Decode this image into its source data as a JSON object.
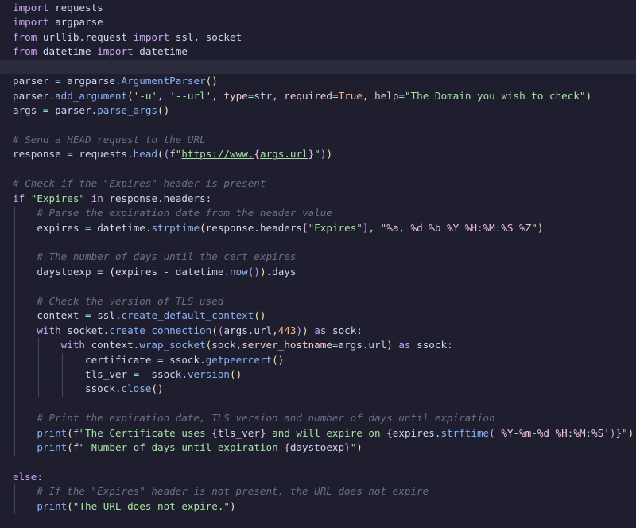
{
  "editor": {
    "language": "Python",
    "lines": [
      {
        "indent": 0,
        "current": false,
        "tokens": [
          [
            "kw",
            "import"
          ],
          [
            "plain",
            " requests"
          ]
        ]
      },
      {
        "indent": 0,
        "current": false,
        "tokens": [
          [
            "kw",
            "import"
          ],
          [
            "plain",
            " argparse"
          ]
        ]
      },
      {
        "indent": 0,
        "current": false,
        "tokens": [
          [
            "kw",
            "from"
          ],
          [
            "plain",
            " urllib.request "
          ],
          [
            "kw",
            "import"
          ],
          [
            "plain",
            " ssl, socket"
          ]
        ]
      },
      {
        "indent": 0,
        "current": false,
        "tokens": [
          [
            "kw",
            "from"
          ],
          [
            "plain",
            " datetime "
          ],
          [
            "kw",
            "import"
          ],
          [
            "plain",
            " datetime"
          ]
        ]
      },
      {
        "indent": 0,
        "current": true,
        "tokens": []
      },
      {
        "indent": 0,
        "current": false,
        "tokens": [
          [
            "plain",
            "parser "
          ],
          [
            "op",
            "="
          ],
          [
            "plain",
            " argparse."
          ],
          [
            "fn",
            "ArgumentParser"
          ],
          [
            "brk1",
            "()"
          ]
        ]
      },
      {
        "indent": 0,
        "current": false,
        "tokens": [
          [
            "plain",
            "parser."
          ],
          [
            "fn",
            "add_argument"
          ],
          [
            "brk1",
            "("
          ],
          [
            "str",
            "'-u'"
          ],
          [
            "plain",
            ", "
          ],
          [
            "str",
            "'--url'"
          ],
          [
            "plain",
            ", "
          ],
          [
            "param",
            "type"
          ],
          [
            "op",
            "="
          ],
          [
            "plain",
            "str, "
          ],
          [
            "param",
            "required"
          ],
          [
            "op",
            "="
          ],
          [
            "const",
            "True"
          ],
          [
            "plain",
            ", "
          ],
          [
            "param",
            "help"
          ],
          [
            "op",
            "="
          ],
          [
            "str",
            "\"The Domain you wish to check\""
          ],
          [
            "brk1",
            ")"
          ]
        ]
      },
      {
        "indent": 0,
        "current": false,
        "tokens": [
          [
            "plain",
            "args "
          ],
          [
            "op",
            "="
          ],
          [
            "plain",
            " parser."
          ],
          [
            "fn",
            "parse_args"
          ],
          [
            "brk1",
            "()"
          ]
        ]
      },
      {
        "indent": 0,
        "current": false,
        "tokens": []
      },
      {
        "indent": 0,
        "current": false,
        "tokens": [
          [
            "com",
            "# Send a HEAD request to the URL"
          ]
        ]
      },
      {
        "indent": 0,
        "current": false,
        "tokens": [
          [
            "plain",
            "response "
          ],
          [
            "op",
            "="
          ],
          [
            "plain",
            " requests."
          ],
          [
            "fn",
            "head"
          ],
          [
            "brk1",
            "("
          ],
          [
            "brk2",
            "("
          ],
          [
            "plain",
            "f"
          ],
          [
            "str",
            "\""
          ],
          [
            "url",
            "https://www."
          ],
          [
            "esc",
            "{"
          ],
          [
            "url",
            "args.url"
          ],
          [
            "esc",
            "}"
          ],
          [
            "str",
            "\""
          ],
          [
            "brk2",
            ")"
          ],
          [
            "brk1",
            ")"
          ]
        ]
      },
      {
        "indent": 0,
        "current": false,
        "tokens": []
      },
      {
        "indent": 0,
        "current": false,
        "tokens": [
          [
            "com",
            "# Check if the \"Expires\" header is present"
          ]
        ]
      },
      {
        "indent": 0,
        "current": false,
        "tokens": [
          [
            "kw",
            "if"
          ],
          [
            "plain",
            " "
          ],
          [
            "str",
            "\"Expires\""
          ],
          [
            "plain",
            " "
          ],
          [
            "kw",
            "in"
          ],
          [
            "plain",
            " response.headers:"
          ]
        ]
      },
      {
        "indent": 1,
        "current": false,
        "tokens": [
          [
            "com",
            "# Parse the expiration date from the header value"
          ]
        ]
      },
      {
        "indent": 1,
        "current": false,
        "tokens": [
          [
            "plain",
            "expires "
          ],
          [
            "op",
            "="
          ],
          [
            "plain",
            " datetime."
          ],
          [
            "fn",
            "strptime"
          ],
          [
            "brk1",
            "("
          ],
          [
            "plain",
            "response.headers"
          ],
          [
            "brk2",
            "["
          ],
          [
            "str",
            "\"Expires\""
          ],
          [
            "brk2",
            "]"
          ],
          [
            "plain",
            ", "
          ],
          [
            "str",
            "\""
          ],
          [
            "esc",
            "%a"
          ],
          [
            "str",
            ", "
          ],
          [
            "esc",
            "%d %b %Y %H"
          ],
          [
            "str",
            ":"
          ],
          [
            "esc",
            "%M"
          ],
          [
            "str",
            ":"
          ],
          [
            "esc",
            "%S %Z"
          ],
          [
            "str",
            "\""
          ],
          [
            "brk1",
            ")"
          ]
        ]
      },
      {
        "indent": 1,
        "current": false,
        "tokens": []
      },
      {
        "indent": 1,
        "current": false,
        "tokens": [
          [
            "com",
            "# The number of days until the cert expires"
          ]
        ]
      },
      {
        "indent": 1,
        "current": false,
        "tokens": [
          [
            "plain",
            "daystoexp "
          ],
          [
            "op",
            "="
          ],
          [
            "plain",
            " "
          ],
          [
            "brk1",
            "("
          ],
          [
            "plain",
            "expires "
          ],
          [
            "op",
            "-"
          ],
          [
            "plain",
            " datetime."
          ],
          [
            "fn",
            "now"
          ],
          [
            "brk2",
            "()"
          ],
          [
            "brk1",
            ")"
          ],
          [
            "plain",
            "."
          ],
          [
            "plain",
            "days"
          ]
        ]
      },
      {
        "indent": 1,
        "current": false,
        "tokens": []
      },
      {
        "indent": 1,
        "current": false,
        "tokens": [
          [
            "com",
            "# Check the version of TLS used"
          ]
        ]
      },
      {
        "indent": 1,
        "current": false,
        "tokens": [
          [
            "plain",
            "context "
          ],
          [
            "op",
            "="
          ],
          [
            "plain",
            " ssl."
          ],
          [
            "fn",
            "create_default_context"
          ],
          [
            "brk1",
            "()"
          ]
        ]
      },
      {
        "indent": 1,
        "current": false,
        "tokens": [
          [
            "kw",
            "with"
          ],
          [
            "plain",
            " socket."
          ],
          [
            "fn",
            "create_connection"
          ],
          [
            "brk1",
            "("
          ],
          [
            "brk2",
            "("
          ],
          [
            "plain",
            "args.url,"
          ],
          [
            "num",
            "443"
          ],
          [
            "brk2",
            ")"
          ],
          [
            "brk1",
            ")"
          ],
          [
            "plain",
            " "
          ],
          [
            "kw",
            "as"
          ],
          [
            "plain",
            " sock:"
          ]
        ]
      },
      {
        "indent": 2,
        "current": false,
        "tokens": [
          [
            "kw",
            "with"
          ],
          [
            "plain",
            " context."
          ],
          [
            "fn",
            "wrap_socket"
          ],
          [
            "brk1",
            "("
          ],
          [
            "plain",
            "sock,"
          ],
          [
            "param",
            "server_hostname"
          ],
          [
            "op",
            "="
          ],
          [
            "plain",
            "args.url"
          ],
          [
            "brk1",
            ")"
          ],
          [
            "plain",
            " "
          ],
          [
            "kw",
            "as"
          ],
          [
            "plain",
            " ssock:"
          ]
        ]
      },
      {
        "indent": 3,
        "current": false,
        "tokens": [
          [
            "plain",
            "certificate "
          ],
          [
            "op",
            "="
          ],
          [
            "plain",
            " ssock."
          ],
          [
            "fn",
            "getpeercert"
          ],
          [
            "brk1",
            "()"
          ]
        ]
      },
      {
        "indent": 3,
        "current": false,
        "tokens": [
          [
            "plain",
            "tls_ver "
          ],
          [
            "op",
            "="
          ],
          [
            "plain",
            "  ssock."
          ],
          [
            "fn",
            "version"
          ],
          [
            "brk1",
            "()"
          ]
        ]
      },
      {
        "indent": 3,
        "current": false,
        "tokens": [
          [
            "plain",
            "ssock."
          ],
          [
            "fn",
            "close"
          ],
          [
            "brk1",
            "()"
          ]
        ]
      },
      {
        "indent": 1,
        "current": false,
        "tokens": []
      },
      {
        "indent": 1,
        "current": false,
        "tokens": [
          [
            "com",
            "# Print the expiration date, TLS version and number of days until expiration"
          ]
        ]
      },
      {
        "indent": 1,
        "current": false,
        "tokens": [
          [
            "fn",
            "print"
          ],
          [
            "brk1",
            "("
          ],
          [
            "plain",
            "f"
          ],
          [
            "str",
            "\"The Certificate uses "
          ],
          [
            "esc",
            "{"
          ],
          [
            "plain",
            "tls_ver"
          ],
          [
            "esc",
            "}"
          ],
          [
            "str",
            " and will expire on "
          ],
          [
            "esc",
            "{"
          ],
          [
            "plain",
            "expires."
          ],
          [
            "fn",
            "strftime"
          ],
          [
            "brk2",
            "("
          ],
          [
            "str",
            "'"
          ],
          [
            "esc",
            "%Y"
          ],
          [
            "str",
            "-"
          ],
          [
            "esc",
            "%m"
          ],
          [
            "str",
            "-"
          ],
          [
            "esc",
            "%d %H"
          ],
          [
            "str",
            ":"
          ],
          [
            "esc",
            "%M"
          ],
          [
            "str",
            ":"
          ],
          [
            "esc",
            "%S"
          ],
          [
            "str",
            "'"
          ],
          [
            "brk2",
            ")"
          ],
          [
            "esc",
            "}"
          ],
          [
            "str",
            "\""
          ],
          [
            "brk1",
            ")"
          ]
        ]
      },
      {
        "indent": 1,
        "current": false,
        "tokens": [
          [
            "fn",
            "print"
          ],
          [
            "brk1",
            "("
          ],
          [
            "plain",
            "f"
          ],
          [
            "str",
            "\" Number of days until expiration "
          ],
          [
            "esc",
            "{"
          ],
          [
            "plain",
            "daystoexp"
          ],
          [
            "esc",
            "}"
          ],
          [
            "str",
            "\""
          ],
          [
            "brk1",
            ")"
          ]
        ]
      },
      {
        "indent": 0,
        "current": false,
        "tokens": []
      },
      {
        "indent": 0,
        "current": false,
        "tokens": [
          [
            "kw",
            "else"
          ],
          [
            "plain",
            ":"
          ]
        ]
      },
      {
        "indent": 1,
        "current": false,
        "tokens": [
          [
            "com",
            "# If the \"Expires\" header is not present, the URL does not expire"
          ]
        ]
      },
      {
        "indent": 1,
        "current": false,
        "tokens": [
          [
            "fn",
            "print"
          ],
          [
            "brk1",
            "("
          ],
          [
            "str",
            "\"The URL does not expire.\""
          ],
          [
            "brk1",
            ")"
          ]
        ]
      }
    ]
  }
}
